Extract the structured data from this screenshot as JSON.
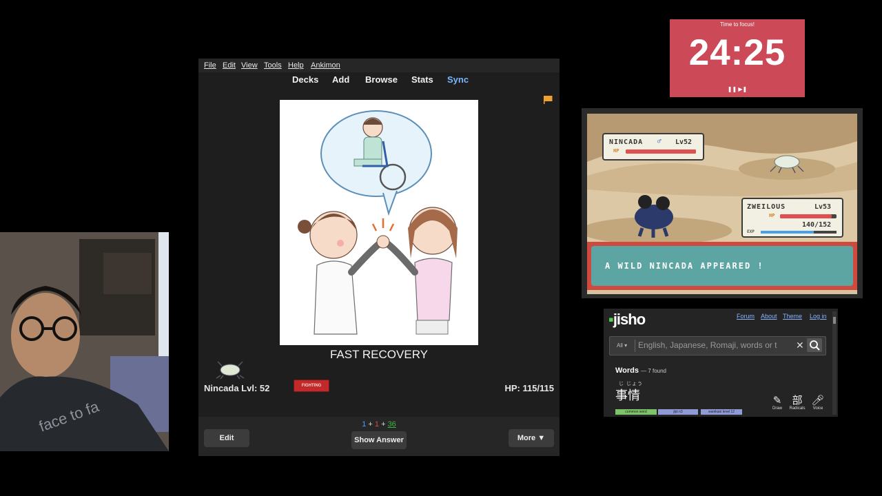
{
  "anki": {
    "menu": [
      "File",
      "Edit",
      "View",
      "Tools",
      "Help",
      "Ankimon"
    ],
    "toolbar": [
      "Decks",
      "Add",
      "Browse",
      "Stats",
      "Sync"
    ],
    "card_title": "FAST RECOVERY",
    "pokemon_name_level": "Nincada Lvl: 52",
    "pokemon_type": "FIGHTING",
    "pokemon_hp": "HP: 115/115",
    "counts": {
      "new": "1",
      "learning": "1",
      "review": "36",
      "sep": "+"
    },
    "buttons": {
      "edit": "Edit",
      "show_answer": "Show Answer",
      "more": "More ▼"
    },
    "accent_colors": {
      "new": "#4b9cff",
      "learning": "#d94a4a",
      "review": "#3fb53f",
      "flag": "#f0a030"
    }
  },
  "timer": {
    "label": "Time to focus!",
    "time": "24:25",
    "controls": "❚❚ ▶❚",
    "color": "#cc4a57"
  },
  "game": {
    "enemy": {
      "name": "NINCADA",
      "gender": "♂",
      "level": "Lv52",
      "hp_label": "HP",
      "hp_fraction": 1.0
    },
    "player": {
      "name": "ZWEILOUS",
      "level": "Lv53",
      "hp_label": "HP",
      "hp_text": "140/152",
      "exp_label": "EXP",
      "hp_fraction": 0.92,
      "exp_fraction": 0.7
    },
    "dialog": "A WILD NINCADA APPEARED !"
  },
  "jisho": {
    "logo": "jisho",
    "nav": [
      "Forum",
      "About",
      "Theme",
      "Log in"
    ],
    "search_scope": "All ▾",
    "search_placeholder": "English, Japanese, Romaji, words or t",
    "words_label": "Words",
    "found": "— 7 found",
    "furigana": "じ じょう",
    "word": "事情",
    "tags": [
      "common word",
      "jlpt n3",
      "wanikani level 12"
    ],
    "tools": [
      {
        "label": "Draw",
        "icon": "pencil-icon"
      },
      {
        "label": "Radicals",
        "icon": "radicals-icon"
      },
      {
        "label": "Voice",
        "icon": "microphone-icon"
      }
    ]
  }
}
